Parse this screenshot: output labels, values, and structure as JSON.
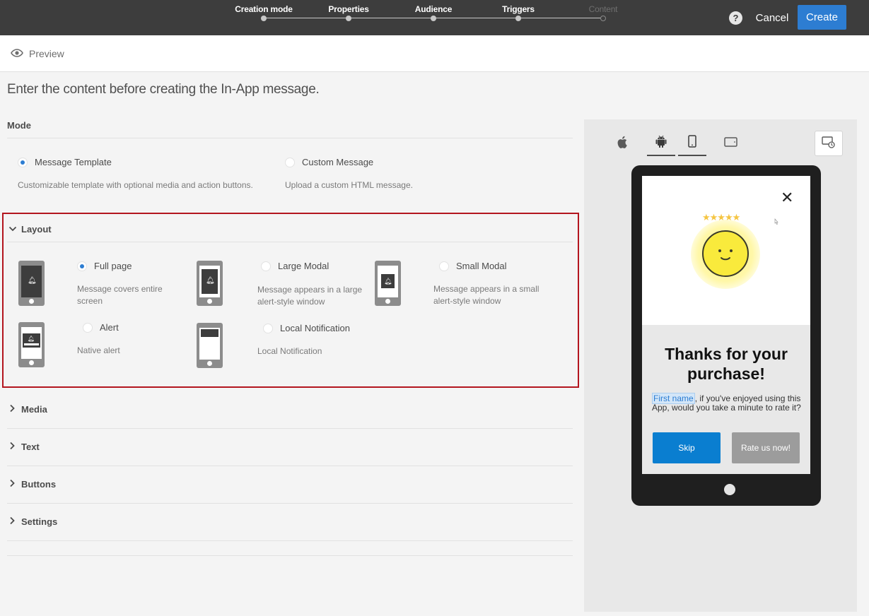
{
  "steps": [
    {
      "label": "Creation mode",
      "state": "done"
    },
    {
      "label": "Properties",
      "state": "done"
    },
    {
      "label": "Audience",
      "state": "done"
    },
    {
      "label": "Triggers",
      "state": "done"
    },
    {
      "label": "Content",
      "state": "current"
    }
  ],
  "header": {
    "help_label": "?",
    "cancel_label": "Cancel",
    "create_label": "Create",
    "accent_color": "#2d7dd2"
  },
  "preview": {
    "label": "Preview",
    "icon": "eye-icon"
  },
  "intro_text": "Enter the content before creating the In-App message.",
  "mode": {
    "heading": "Mode",
    "options": [
      {
        "label": "Message Template",
        "description": "Customizable template with optional media and action buttons.",
        "selected": true
      },
      {
        "label": "Custom Message",
        "description": "Upload a custom HTML message.",
        "selected": false
      }
    ]
  },
  "layout": {
    "heading": "Layout",
    "options": [
      {
        "label": "Full page",
        "description": "Message covers entire screen",
        "selected": true
      },
      {
        "label": "Large Modal",
        "description": "Message appears in a large alert-style window",
        "selected": false
      },
      {
        "label": "Small Modal",
        "description": "Message appears in a small alert-style window",
        "selected": false
      },
      {
        "label": "Alert",
        "description": "Native alert",
        "selected": false
      },
      {
        "label": "Local Notification",
        "description": "Local Notification",
        "selected": false
      }
    ]
  },
  "sections": [
    {
      "label": "Media"
    },
    {
      "label": "Text"
    },
    {
      "label": "Buttons"
    },
    {
      "label": "Settings"
    }
  ],
  "device_preview": {
    "tabs": [
      {
        "icon": "apple-icon",
        "active": false
      },
      {
        "icon": "android-icon",
        "active": true
      },
      {
        "icon": "phone-icon",
        "active": true
      },
      {
        "icon": "tablet-icon",
        "active": false
      }
    ],
    "rotate_icon": "rotate-icon",
    "close_icon": "close-icon",
    "stars": "★★★★★",
    "title": "Thanks for your purchase!",
    "personalization_field": "First name",
    "body_text": ", if you've enjoyed using this App, would you take a minute to rate it?",
    "skip_label": "Skip",
    "rate_label": "Rate us now!"
  }
}
